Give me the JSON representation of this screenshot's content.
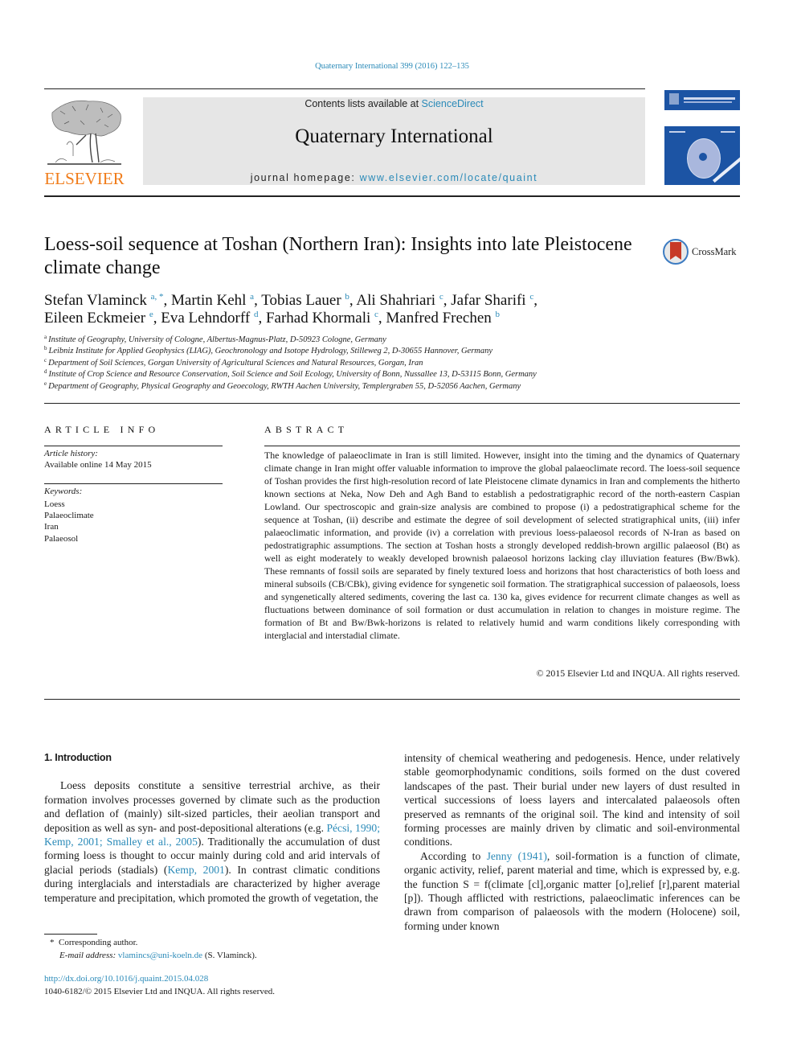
{
  "running_head": "Quaternary International 399 (2016) 122–135",
  "masthead": {
    "publisher_logo_text": "ELSEVIER",
    "contents_prefix": "Contents lists available at ",
    "contents_link": "ScienceDirect",
    "journal_title": "Quaternary International",
    "homepage_prefix": "journal homepage: ",
    "homepage_link": "www.elsevier.com/locate/quaint",
    "colors": {
      "publisher_orange": "#f07c1a",
      "link_blue": "#2a8ab8",
      "cover_blue": "#1c54a4",
      "masthead_gray": "#e6e6e6"
    }
  },
  "article": {
    "title": "Loess-soil sequence at Toshan (Northern Iran): Insights into late Pleistocene climate change",
    "crossmark_label": "CrossMark",
    "authors": [
      {
        "name": "Stefan Vlaminck",
        "sup": "a, *",
        "sep": ", "
      },
      {
        "name": "Martin Kehl",
        "sup": "a",
        "sep": ", "
      },
      {
        "name": "Tobias Lauer",
        "sup": "b",
        "sep": ", "
      },
      {
        "name": "Ali Shahriari",
        "sup": "c",
        "sep": ", "
      },
      {
        "name": "Jafar Sharifi",
        "sup": "c",
        "sep": ", "
      },
      {
        "name": "Eileen Eckmeier",
        "sup": "e",
        "sep": ", "
      },
      {
        "name": "Eva Lehndorff",
        "sup": "d",
        "sep": ", "
      },
      {
        "name": "Farhad Khormali",
        "sup": "c",
        "sep": ", "
      },
      {
        "name": "Manfred Frechen",
        "sup": "b",
        "sep": ""
      }
    ],
    "affiliations": [
      {
        "key": "a",
        "text": "Institute of Geography, University of Cologne, Albertus-Magnus-Platz, D-50923 Cologne, Germany"
      },
      {
        "key": "b",
        "text": "Leibniz Institute for Applied Geophysics (LIAG), Geochronology and Isotope Hydrology, Stilleweg 2, D-30655 Hannover, Germany"
      },
      {
        "key": "c",
        "text": "Department of Soil Sciences, Gorgan University of Agricultural Sciences and Natural Resources, Gorgan, Iran"
      },
      {
        "key": "d",
        "text": "Institute of Crop Science and Resource Conservation, Soil Science and Soil Ecology, University of Bonn, Nussallee 13, D-53115 Bonn, Germany"
      },
      {
        "key": "e",
        "text": "Department of Geography, Physical Geography and Geoecology, RWTH Aachen University, Templergraben 55, D-52056 Aachen, Germany"
      }
    ]
  },
  "article_info": {
    "heading": "ARTICLE INFO",
    "history_label": "Article history:",
    "history_value": "Available online 14 May 2015",
    "keywords_label": "Keywords:",
    "keywords": [
      "Loess",
      "Palaeoclimate",
      "Iran",
      "Palaeosol"
    ]
  },
  "abstract": {
    "heading": "ABSTRACT",
    "body": "The knowledge of palaeoclimate in Iran is still limited. However, insight into the timing and the dynamics of Quaternary climate change in Iran might offer valuable information to improve the global palae­oclimate record. The loess-soil sequence of Toshan provides the first high-resolution record of late Pleistocene climate dynamics in Iran and complements the hitherto known sections at Neka, Now Deh and Agh Band to establish a pedostratigraphic record of the north-eastern Caspian Lowland. Our spec­troscopic and grain-size analysis are combined to propose (i) a pedostratigraphical scheme for the sequence at Toshan, (ii) describe and estimate the degree of soil development of selected stratigraphical units, (iii) infer palaeoclimatic information, and provide (iv) a correlation with previous loess-palaeosol records of N-Iran as based on pedostratigraphic assumptions. The section at Toshan hosts a strongly developed reddish-brown argillic palaeosol (Bt) as well as eight moderately to weakly developed brownish palaeosol horizons lacking clay illuviation features (Bw/Bwk). These remnants of fossil soils are separated by finely textured loess and horizons that host characteristics of both loess and mineral subsoils (CB/CBk), giving evidence for syngenetic soil formation. The stratigraphical succession of palaeosols, loess and syngenetically altered sediments, covering the last ca. 130 ka, gives evidence for recurrent climate changes as well as fluctuations between dominance of soil formation or dust accu­mulation in relation to changes in moisture regime. The formation of Bt and Bw/Bwk-horizons is related to relatively humid and warm conditions likely corresponding with interglacial and interstadial climate.",
    "copyright": "© 2015 Elsevier Ltd and INQUA. All rights reserved."
  },
  "introduction": {
    "heading": "1.  Introduction",
    "p1_a": "Loess deposits constitute a sensitive terrestrial archive, as their formation involves processes governed by climate such as the production and deflation of (mainly) silt-sized particles, their aeolian transport and deposition as well as syn- and post-depositional alterations (e.g. ",
    "p1_cite1": "Pécsi, 1990; Kemp, 2001; Smalley et al., 2005",
    "p1_b": "). Traditionally the accumulation of dust forming loess is thought to occur mainly during cold and arid intervals of glacial periods (stadials) (",
    "p1_cite2": "Kemp, 2001",
    "p1_c": "). In contrast climatic conditions during interglacials and interstadials are characterized by higher average temperature and precipitation, which promoted the growth of vegetation, the intensity of chemical weathering and pedogenesis. Hence, under relatively stable geomorphodynamic conditions, soils formed on the dust covered landscapes of the past. Their burial under new layers of dust resulted in vertical succes­sions of loess layers and intercalated palaeosols often preserved as remnants of the original soil. The kind and intensity of soil forming processes are mainly driven by climatic and soil-environmental conditions.",
    "p2_a": "According to ",
    "p2_cite": "Jenny (1941)",
    "p2_b": ", soil-formation is a function of climate, organic activity, relief, parent material and time, which is expressed by, e.g. the function S = f(climate [cl],organic matter [o],relief [r],parent material [p]). Though afflicted with restrictions, palaeoclimatic inferences can be drawn from comparison of palaeosols with the modern (Holocene) soil, forming under known"
  },
  "footnotes": {
    "corresponding_marker": "*",
    "corresponding_text": "Corresponding author.",
    "email_label": "E-mail address:",
    "email": "vlamincs@uni-koeln.de",
    "email_suffix": " (S. Vlaminck).",
    "doi": "http://dx.doi.org/10.1016/j.quaint.2015.04.028",
    "issn_copyright": "1040-6182/© 2015 Elsevier Ltd and INQUA. All rights reserved."
  }
}
